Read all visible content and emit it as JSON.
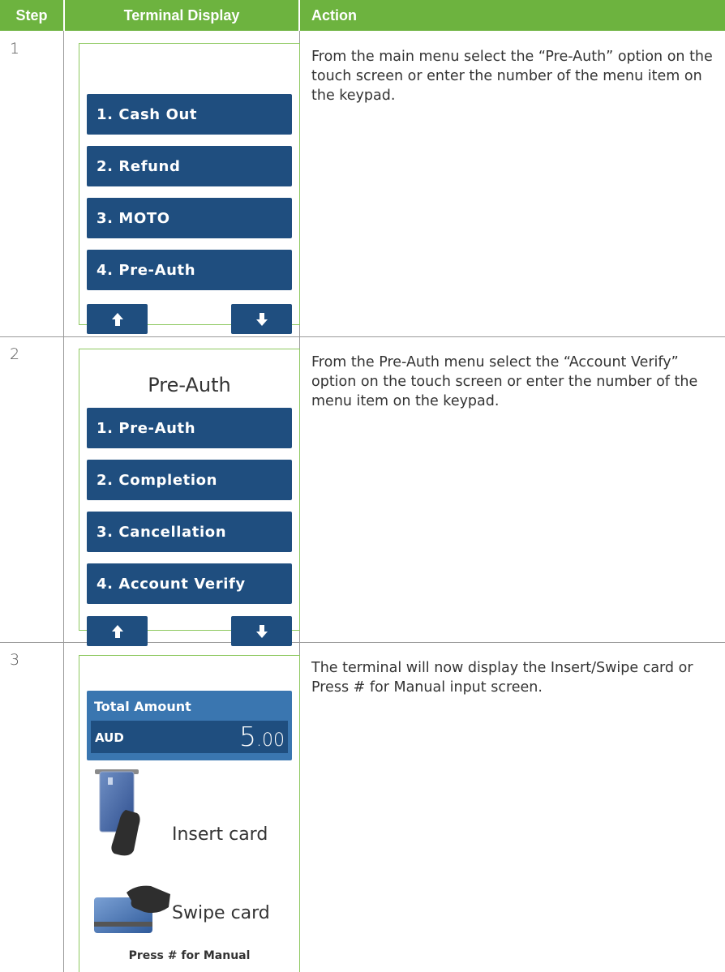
{
  "header": {
    "step": "Step",
    "terminal_display": "Terminal Display",
    "action": "Action"
  },
  "rows": [
    {
      "step": "1",
      "menu": [
        "1. Cash Out",
        "2. Refund",
        "3. MOTO",
        "4. Pre-Auth"
      ],
      "action": "From the main menu select the “Pre-Auth” option on the touch screen or enter the number of the menu item on the keypad."
    },
    {
      "step": "2",
      "title": "Pre-Auth",
      "menu": [
        "1. Pre-Auth",
        "2. Completion",
        "3. Cancellation",
        "4. Account Verify"
      ],
      "action": "From the Pre-Auth menu select the “Account Verify” option on the touch screen or enter the number of the menu item on the keypad."
    },
    {
      "step": "3",
      "total_label": "Total Amount",
      "currency": "AUD",
      "amount_whole": "5",
      "amount_fraction": ".00",
      "insert_label": "Insert card",
      "swipe_label": "Swipe card",
      "manual_label": "Press # for Manual",
      "action": "The terminal will now display the Insert/Swipe card or Press # for Manual input screen."
    }
  ],
  "colors": {
    "header_green": "#6db33f",
    "button_blue": "#1f4e7f",
    "amount_blue": "#3a76b0",
    "frame_green": "#8dc85f"
  },
  "icons": [
    "arrow-up-icon",
    "arrow-down-icon",
    "card-insert-icon",
    "card-swipe-icon"
  ]
}
